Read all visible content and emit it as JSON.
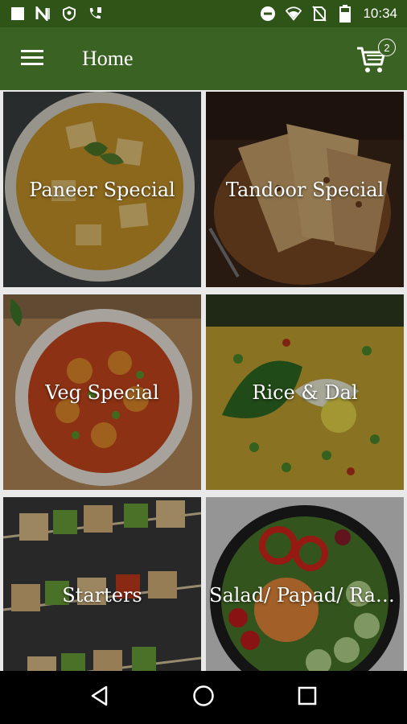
{
  "status_bar": {
    "time": "10:34",
    "icons_left": [
      "square-icon",
      "n-icon",
      "shield-icon",
      "phone-icon"
    ],
    "icons_right": [
      "dnd-icon",
      "wifi-icon",
      "no-sim-icon",
      "battery-icon"
    ]
  },
  "app_bar": {
    "title": "Home",
    "cart_count": "2"
  },
  "categories": [
    {
      "label": "Paneer Special"
    },
    {
      "label": "Tandoor Special"
    },
    {
      "label": "Veg Special"
    },
    {
      "label": "Rice & Dal"
    },
    {
      "label": "Starters"
    },
    {
      "label": "Salad/ Papad/ Raita"
    }
  ],
  "colors": {
    "status_bar": "#2f5418",
    "app_bar": "#3a6222"
  }
}
